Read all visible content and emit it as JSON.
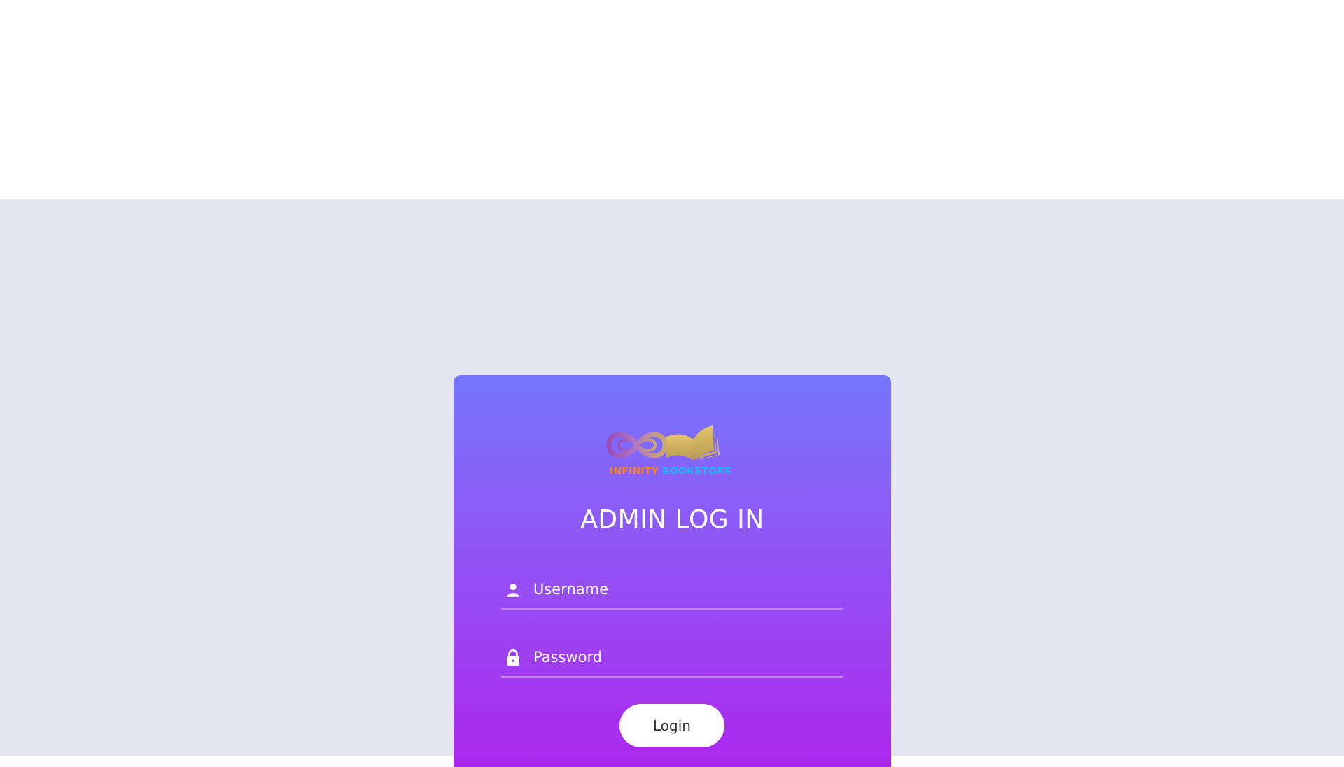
{
  "logo": {
    "word1": "INFINITY",
    "word2": "BOOKSTORE",
    "icon": "infinity-book-logo-icon",
    "color_word1": "#f7841f",
    "color_word2": "#21b6f2"
  },
  "login_card": {
    "title": "ADMIN LOG IN",
    "username": {
      "placeholder": "Username",
      "value": "",
      "icon": "user-icon"
    },
    "password": {
      "placeholder": "Password",
      "value": "",
      "icon": "lock-icon"
    },
    "login_label": "Login",
    "gradient_top": "#7676fd",
    "gradient_bottom": "#ab27ee"
  },
  "colors": {
    "page_background": "#e6e6f3",
    "header_background": "#ffffff"
  }
}
